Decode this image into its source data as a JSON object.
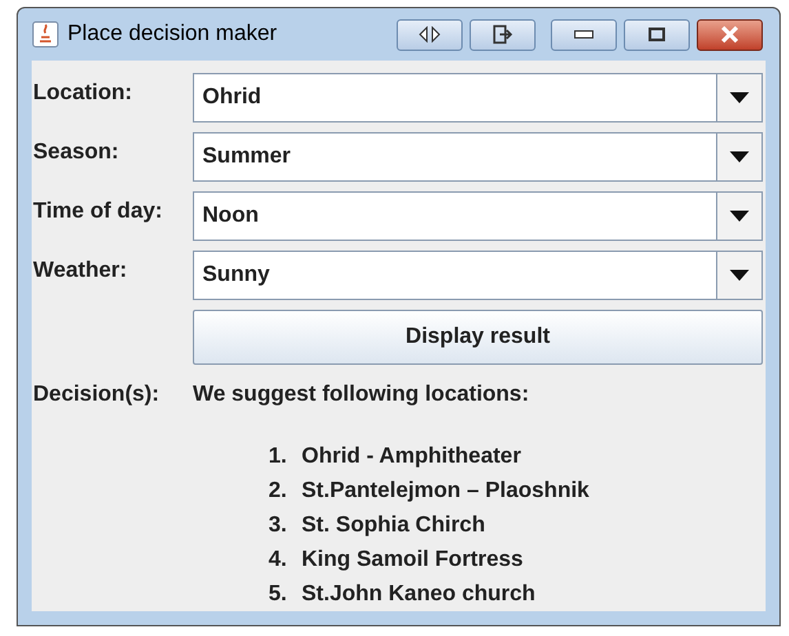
{
  "window": {
    "title": "Place decision maker"
  },
  "fields": [
    {
      "label": "Location:",
      "value": "Ohrid"
    },
    {
      "label": "Season:",
      "value": "Summer"
    },
    {
      "label": "Time of day:",
      "value": "Noon"
    },
    {
      "label": "Weather:",
      "value": "Sunny"
    }
  ],
  "button": "Display result",
  "decision": {
    "label": "Decision(s):",
    "heading": "We suggest following locations:",
    "items": [
      {
        "number": "1.",
        "text": "Ohrid - Amphitheater"
      },
      {
        "number": "2.",
        "text": "St.Pantelejmon – Plaoshnik"
      },
      {
        "number": "3.",
        "text": "St. Sophia Chirch"
      },
      {
        "number": "4.",
        "text": "King Samoil Fortress"
      },
      {
        "number": "5.",
        "text": "St.John Kaneo church"
      }
    ]
  }
}
